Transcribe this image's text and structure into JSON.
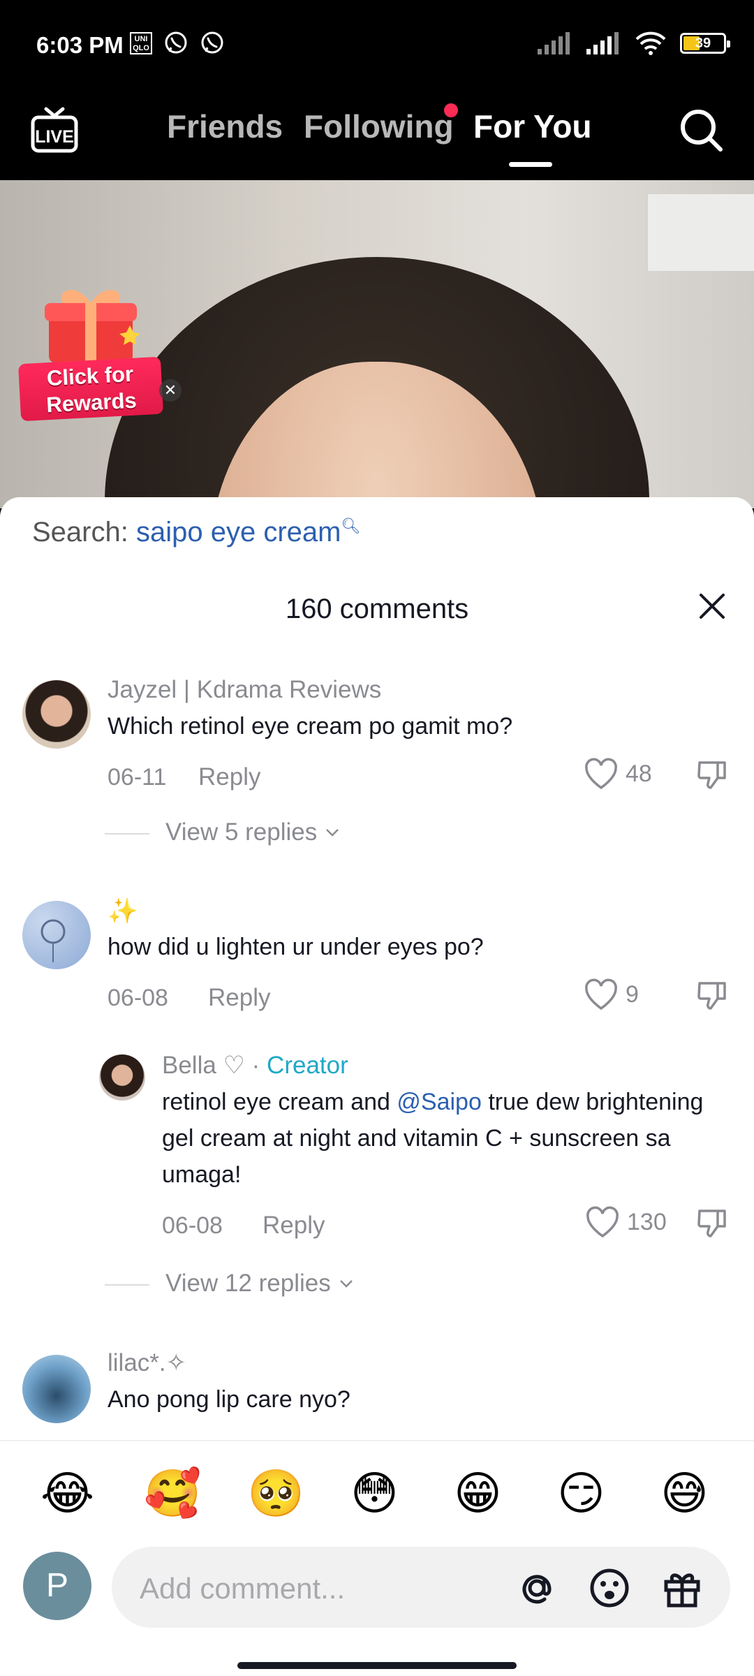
{
  "status_bar": {
    "time": "6:03 PM",
    "uniqlo_label": "UNI QLO",
    "battery": "39"
  },
  "top_nav": {
    "live_label": "LIVE",
    "tabs": [
      {
        "label": "Friends"
      },
      {
        "label": "Following"
      },
      {
        "label": "For You"
      }
    ],
    "active_tab": "For You"
  },
  "video": {
    "reward_label_line1": "Click for",
    "reward_label_line2": "Rewards"
  },
  "comments_sheet": {
    "search_prefix": "Search:",
    "search_keyword": "saipo eye cream",
    "title": "160 comments",
    "comments": [
      {
        "user": "Jayzel | Kdrama Reviews",
        "text": "Which retinol eye cream po gamit mo?",
        "date": "06-11",
        "reply_label": "Reply",
        "likes": "48",
        "view_replies": "View 5 replies"
      },
      {
        "user": "✨",
        "text": "how did u lighten ur under eyes po?",
        "date": "06-08",
        "reply_label": "Reply",
        "likes": "9",
        "reply": {
          "user": "Bella ♡",
          "separator": " · ",
          "badge": "Creator",
          "text_before": "retinol eye cream and ",
          "mention": "@Saipo",
          "text_line1_after": " true dew brightening",
          "text_line2": "gel cream at night and vitamin C + sunscreen sa",
          "text_line3": "umaga!",
          "date": "06-08",
          "reply_label": "Reply",
          "likes": "130"
        },
        "view_replies": "View 12 replies"
      },
      {
        "user": "lilac*.✧",
        "text": "Ano pong lip care nyo?"
      }
    ]
  },
  "emoji_bar": [
    "😂",
    "🥰",
    "🥺",
    "😳",
    "😁",
    "😏",
    "😅"
  ],
  "input": {
    "self_initial": "P",
    "placeholder": "Add comment..."
  },
  "colors": {
    "accent_red": "#fe2c55",
    "creator_blue": "#20a8c6",
    "mention_blue": "#2c5fb0"
  }
}
